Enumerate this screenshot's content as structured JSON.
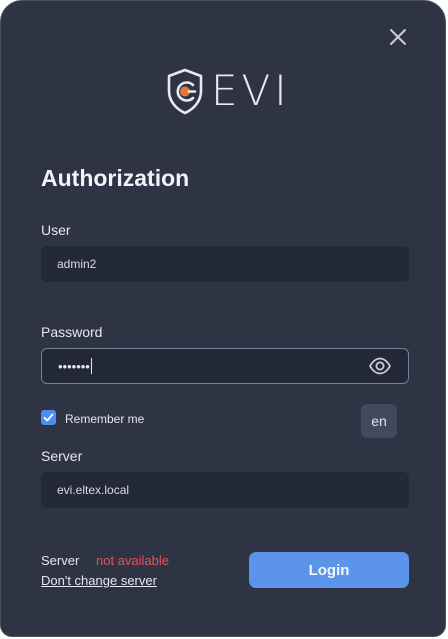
{
  "window": {
    "logo_text": "EVI",
    "title": "Authorization"
  },
  "user": {
    "label": "User",
    "value": "admin2"
  },
  "password": {
    "label": "Password",
    "masked_value": "•••••••"
  },
  "remember": {
    "label": "Remember me",
    "checked": true
  },
  "language": {
    "value": "en"
  },
  "server": {
    "label": "Server",
    "value": "evi.eltex.local"
  },
  "status": {
    "label": "Server",
    "value": "not available",
    "link": "Don't change server"
  },
  "actions": {
    "login_label": "Login"
  },
  "colors": {
    "background": "#2e3443",
    "input_bg": "#242938",
    "accent": "#5b94e8",
    "error": "#e0555a",
    "logo_accent": "#e8763a"
  },
  "icons": {
    "close": "close-icon",
    "logo": "shield-logo-icon",
    "eye": "eye-icon",
    "check": "checkmark-icon"
  }
}
